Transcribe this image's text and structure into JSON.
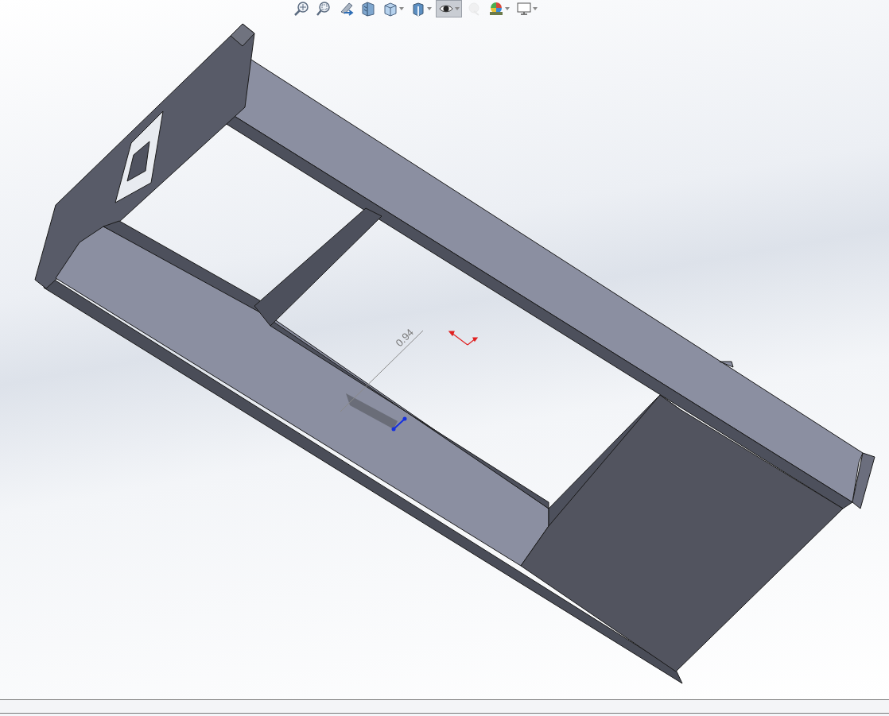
{
  "toolbar": {
    "buttons": [
      {
        "kind": "zoom-fit",
        "selected": false,
        "disabled": false,
        "dropdown": false
      },
      {
        "kind": "zoom-area",
        "selected": false,
        "disabled": false,
        "dropdown": false
      },
      {
        "kind": "previous-view",
        "selected": false,
        "disabled": false,
        "dropdown": false
      },
      {
        "kind": "section-view",
        "selected": false,
        "disabled": false,
        "dropdown": false
      },
      {
        "kind": "view-orientation",
        "selected": false,
        "disabled": false,
        "dropdown": true
      },
      {
        "kind": "display-style",
        "selected": false,
        "disabled": false,
        "dropdown": true
      },
      {
        "kind": "hide-show",
        "selected": true,
        "disabled": false,
        "dropdown": true
      },
      {
        "kind": "edit-appearance",
        "selected": false,
        "disabled": true,
        "dropdown": false
      },
      {
        "kind": "scene",
        "selected": false,
        "disabled": false,
        "dropdown": true
      },
      {
        "kind": "display",
        "selected": false,
        "disabled": false,
        "dropdown": true
      }
    ]
  },
  "dimension": {
    "value": "0.94"
  }
}
